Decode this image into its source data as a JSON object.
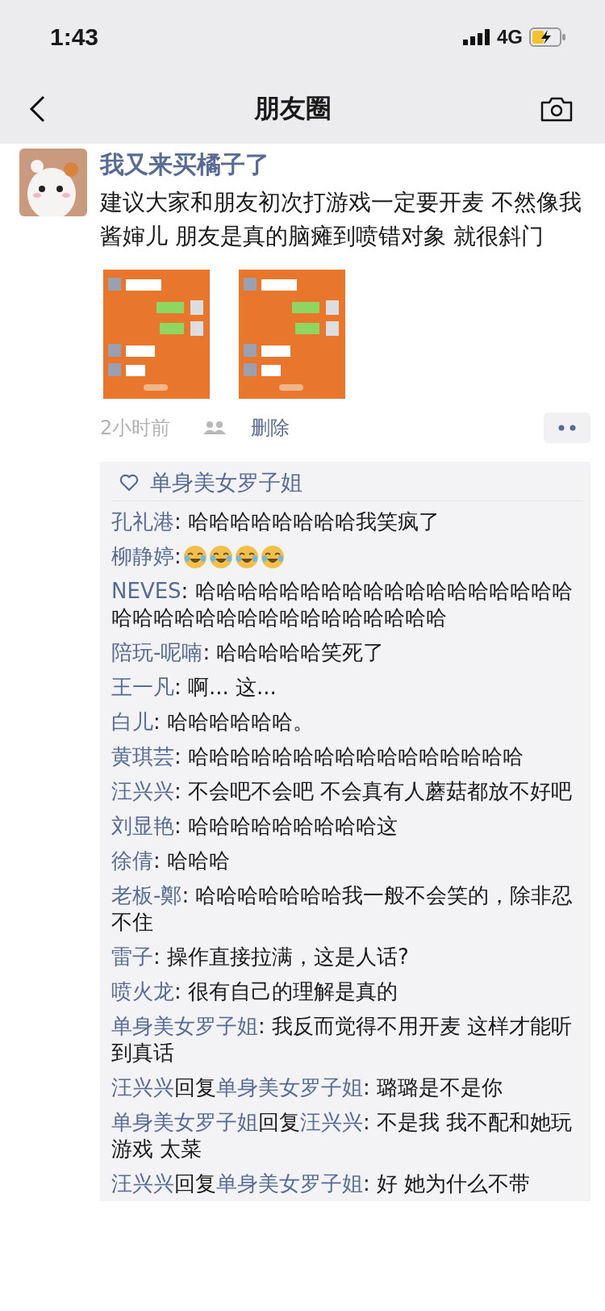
{
  "status_bar": {
    "time": "1:43",
    "network": "4G"
  },
  "nav_bar": {
    "title": "朋友圈"
  },
  "post": {
    "author": "我又来买橘子了",
    "text": "建议大家和朋友初次打游戏一定要开麦 不然像我酱婶儿 朋友是真的脑瘫到喷错对象 就很斜门",
    "images": [
      {
        "kind": "picture"
      },
      {
        "kind": "picture"
      }
    ],
    "time": "2小时前",
    "delete_label": "删除",
    "likes": [
      "单身美女罗子姐"
    ],
    "comments": [
      {
        "kind": "comment",
        "name": "孔礼港",
        "text": ": 哈哈哈哈哈哈哈哈我笑疯了"
      },
      {
        "kind": "emoji",
        "name": "柳静婷",
        "text": ": ",
        "emojis": [
          {
            "kind": "tears-of-joy"
          },
          {
            "kind": "tears-of-joy"
          },
          {
            "kind": "tears-of-joy"
          },
          {
            "kind": "tears-of-joy"
          }
        ]
      },
      {
        "kind": "comment",
        "name": "NEVES",
        "text": ": 哈哈哈哈哈哈哈哈哈哈哈哈哈哈哈哈哈哈哈哈哈哈哈哈哈哈哈哈哈哈哈哈哈哈"
      },
      {
        "kind": "comment",
        "name": "陪玩-呢喃",
        "text": ": 哈哈哈哈哈笑死了"
      },
      {
        "kind": "comment",
        "name": "王一凡",
        "text": ": 啊... 这..."
      },
      {
        "kind": "comment",
        "name": "白儿",
        "text": ": 哈哈哈哈哈哈。"
      },
      {
        "kind": "comment",
        "name": "黄琪芸",
        "text": ": 哈哈哈哈哈哈哈哈哈哈哈哈哈哈哈哈"
      },
      {
        "kind": "comment",
        "name": "汪兴兴",
        "text": ": 不会吧不会吧 不会真有人蘑菇都放不好吧"
      },
      {
        "kind": "comment",
        "name": "刘显艳",
        "text": ": 哈哈哈哈哈哈哈哈哈这"
      },
      {
        "kind": "comment",
        "name": "徐倩",
        "text": ": 哈哈哈"
      },
      {
        "kind": "comment",
        "name": "老板-鄭",
        "text": ": 哈哈哈哈哈哈哈我一般不会笑的，除非忍不住"
      },
      {
        "kind": "comment",
        "name": "雷子",
        "text": ": 操作直接拉满，这是人话?"
      },
      {
        "kind": "comment",
        "name": "喷火龙",
        "text": ": 很有自己的理解是真的"
      },
      {
        "kind": "comment",
        "name": "单身美女罗子姐",
        "text": ": 我反而觉得不用开麦 这样才能听到真话"
      },
      {
        "kind": "reply",
        "name": "汪兴兴",
        "reply_word": "回复",
        "target": "单身美女罗子姐",
        "text": ": 璐璐是不是你"
      },
      {
        "kind": "reply",
        "name": "单身美女罗子姐",
        "reply_word": "回复",
        "target": "汪兴兴",
        "text": ": 不是我 我不配和她玩游戏 太菜"
      },
      {
        "kind": "reply",
        "name": "汪兴兴",
        "reply_word": "回复",
        "target": "单身美女罗子姐",
        "text": ": 好 她为什么不带"
      }
    ]
  }
}
